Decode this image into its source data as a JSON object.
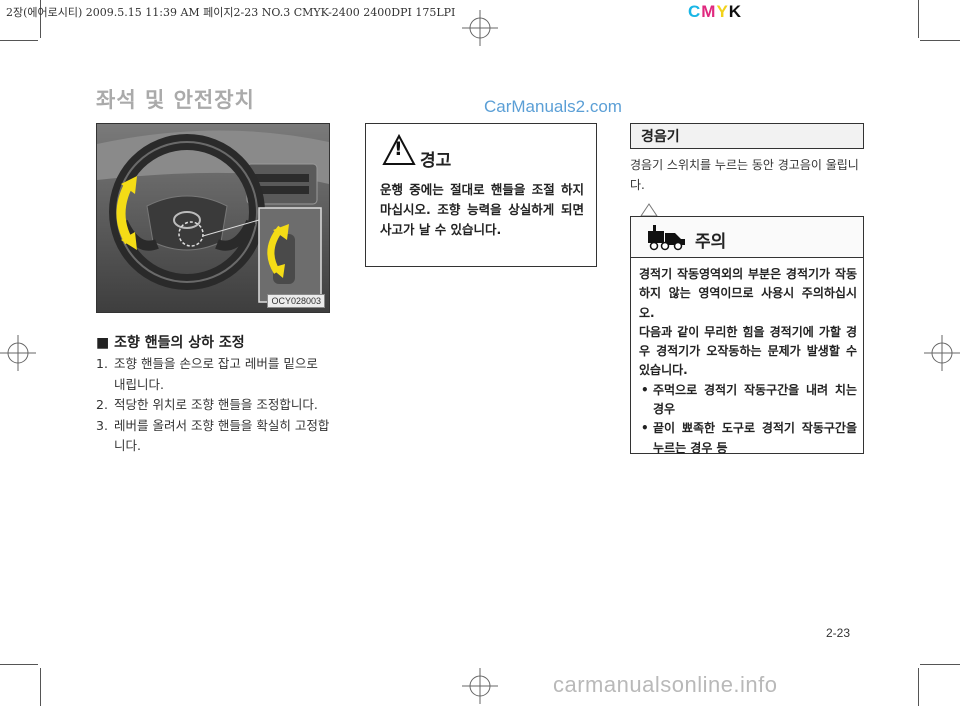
{
  "header": {
    "print_info": "2장(에어로시티)  2009.5.15 11:39 AM  페이지2-23   NO.3 CMYK-2400 2400DPI 175LPI",
    "cmyk": [
      "C",
      "M",
      "Y",
      "K"
    ]
  },
  "section_title": "좌석 및 안전장치",
  "watermark": "CarManuals2.com",
  "figure": {
    "code": "OCY028003"
  },
  "steering": {
    "heading": "■ 조향 핸들의 상하 조정",
    "steps": [
      {
        "num": "1.",
        "text": "조향 핸들을 손으로 잡고 레버를 밑으로 내립니다."
      },
      {
        "num": "2.",
        "text": "적당한 위치로 조향 핸들을 조정합니다."
      },
      {
        "num": "3.",
        "text": "레버를 올려서 조향 핸들을 확실히 고정합니다."
      }
    ]
  },
  "warning": {
    "title": "경고",
    "icon_symbol": "!",
    "body": "운행 중에는 절대로 핸들을 조절 하지 마십시오. 조향 능력을 상실하게 되면 사고가 날 수 있습니다."
  },
  "horn": {
    "title": "경음기",
    "description": "경음기 스위치를 누르는 동안 경고음이 울립니다."
  },
  "caution": {
    "title": "주의",
    "paragraphs": [
      "경적기 작동영역외의 부분은 경적기가 작동하지 않는 영역이므로 사용시 주의하십시오.",
      "다음과 같이 무리한 힘을 경적기에 가할 경우 경적기가 오작동하는 문제가 발생할 수 있습니다."
    ],
    "bullets": [
      "주먹으로 경적기 작동구간을 내려 치는 경우",
      "끝이 뾰족한 도구로 경적기 작동구간을 누르는 경우 등"
    ]
  },
  "page_number": "2-23",
  "footer_watermark": "carmanualsonline.info",
  "colors": {
    "cyan": "#19b6e6",
    "magenta": "#e0287e",
    "yellow": "#f2d21a",
    "arrow_yellow": "#f4dc16",
    "section_title_gray": "#aaaaaa",
    "watermark_blue": "#5b9fd6"
  }
}
